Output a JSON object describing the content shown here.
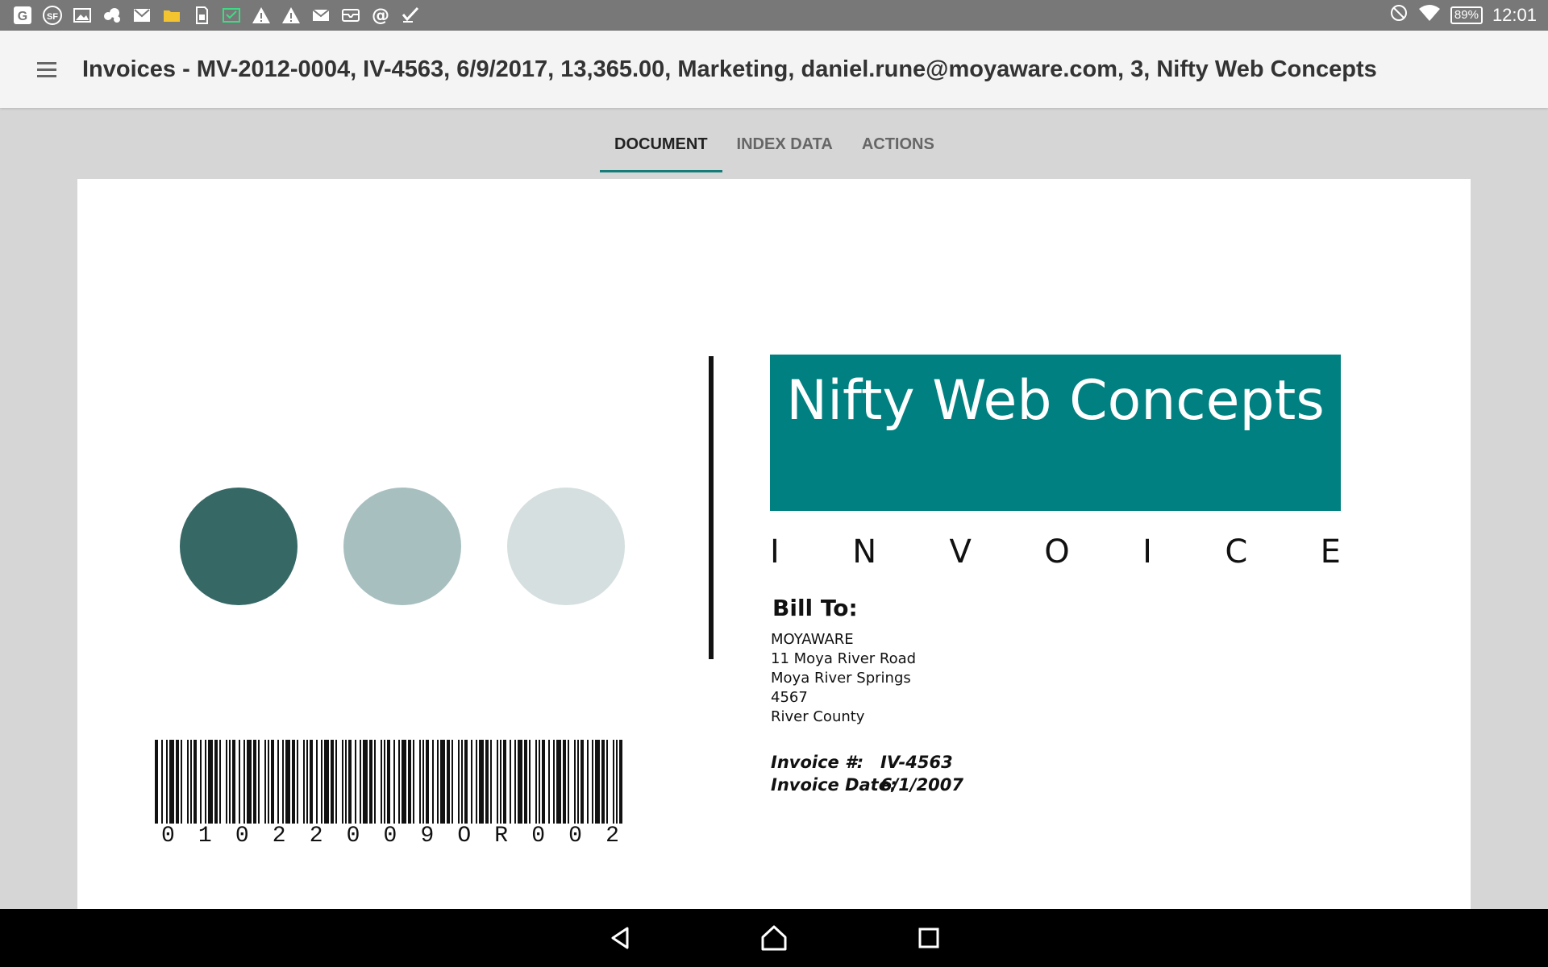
{
  "status_bar": {
    "icons": [
      "google-icon",
      "sf-icon",
      "image-icon",
      "cloud-share-icon",
      "gmail-icon",
      "folder-icon",
      "sim-icon",
      "email-check-icon",
      "warning-icon",
      "warning-icon",
      "mail-icon",
      "inbox-icon",
      "at-icon",
      "task-icon"
    ],
    "right_icons": [
      "do-not-disturb-icon",
      "wifi-icon",
      "battery-icon"
    ],
    "battery": "89%",
    "time": "12:01"
  },
  "appbar": {
    "title": "Invoices - MV-2012-0004, IV-4563, 6/9/2017, 13,365.00, Marketing, daniel.rune@moyaware.com, 3, Nifty Web Concepts"
  },
  "tabs": [
    {
      "label": "DOCUMENT",
      "active": true
    },
    {
      "label": "INDEX DATA",
      "active": false
    },
    {
      "label": "ACTIONS",
      "active": false
    }
  ],
  "document": {
    "company": "Nifty Web Concepts",
    "circles": [
      "#366866",
      "#a8bfc0",
      "#d5dfdf"
    ],
    "brand_color": "#008080",
    "invoice_letters": [
      "I",
      "N",
      "V",
      "O",
      "I",
      "C",
      "E"
    ],
    "bill_to_label": "Bill To:",
    "address": {
      "line1": "MOYAWARE",
      "line2": "11 Moya River Road",
      "line3": "Moya River Springs",
      "line4": "4567",
      "line5": "River County"
    },
    "invoice_number_label": "Invoice #:",
    "invoice_number": "IV-4563",
    "invoice_date_label": "Invoice Date:",
    "invoice_date": "6/1/2007",
    "barcode_digits": [
      "0",
      "1",
      "0",
      "2",
      "2",
      "0",
      "0",
      "9",
      "O",
      "R",
      "0",
      "0",
      "2"
    ]
  },
  "nav": {
    "icons": [
      "back-icon",
      "home-icon",
      "recents-icon"
    ]
  }
}
